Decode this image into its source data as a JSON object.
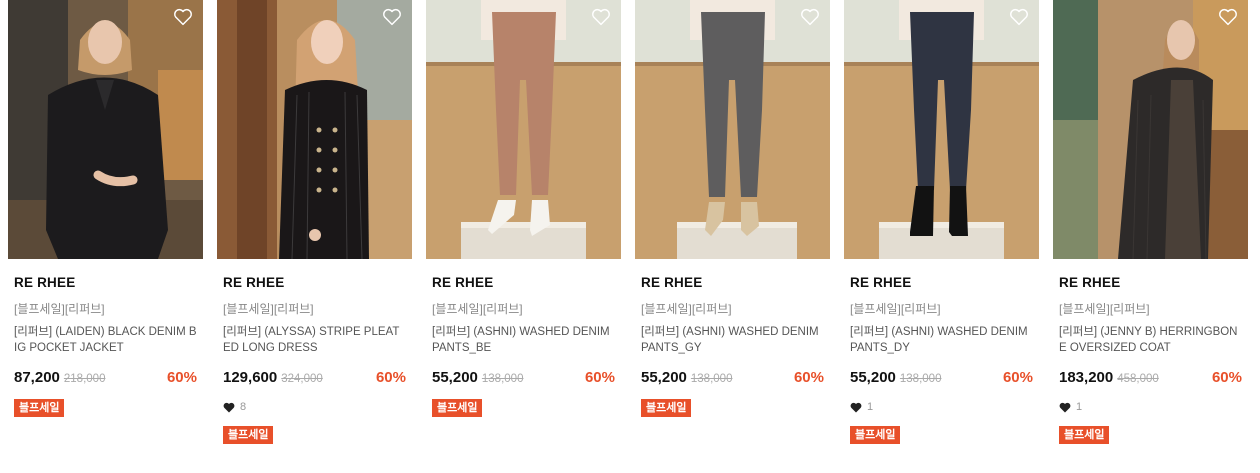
{
  "colors": {
    "accent": "#e8502a"
  },
  "products": [
    {
      "brand": "RE RHEE",
      "promo": "[블프세일][리퍼브]",
      "name": "[리퍼브] (LAIDEN) BLACK DENIM BIG POCKET JACKET",
      "price": "87,200",
      "original_price": "218,000",
      "discount": "60%",
      "likes": null,
      "badge": "블프세일"
    },
    {
      "brand": "RE RHEE",
      "promo": "[블프세일][리퍼브]",
      "name": "[리퍼브] (ALYSSA) STRIPE PLEATED LONG DRESS",
      "price": "129,600",
      "original_price": "324,000",
      "discount": "60%",
      "likes": "8",
      "badge": "블프세일"
    },
    {
      "brand": "RE RHEE",
      "promo": "[블프세일][리퍼브]",
      "name": "[리퍼브] (ASHNI) WASHED DENIM PANTS_BE",
      "price": "55,200",
      "original_price": "138,000",
      "discount": "60%",
      "likes": null,
      "badge": "블프세일"
    },
    {
      "brand": "RE RHEE",
      "promo": "[블프세일][리퍼브]",
      "name": "[리퍼브] (ASHNI) WASHED DENIM PANTS_GY",
      "price": "55,200",
      "original_price": "138,000",
      "discount": "60%",
      "likes": null,
      "badge": "블프세일"
    },
    {
      "brand": "RE RHEE",
      "promo": "[블프세일][리퍼브]",
      "name": "[리퍼브] (ASHNI) WASHED DENIM PANTS_DY",
      "price": "55,200",
      "original_price": "138,000",
      "discount": "60%",
      "likes": "1",
      "badge": "블프세일"
    },
    {
      "brand": "RE RHEE",
      "promo": "[블프세일][리퍼브]",
      "name": "[리퍼브] (JENNY B) HERRINGBONE OVERSIZED COAT",
      "price": "183,200",
      "original_price": "458,000",
      "discount": "60%",
      "likes": "1",
      "badge": "블프세일"
    }
  ]
}
